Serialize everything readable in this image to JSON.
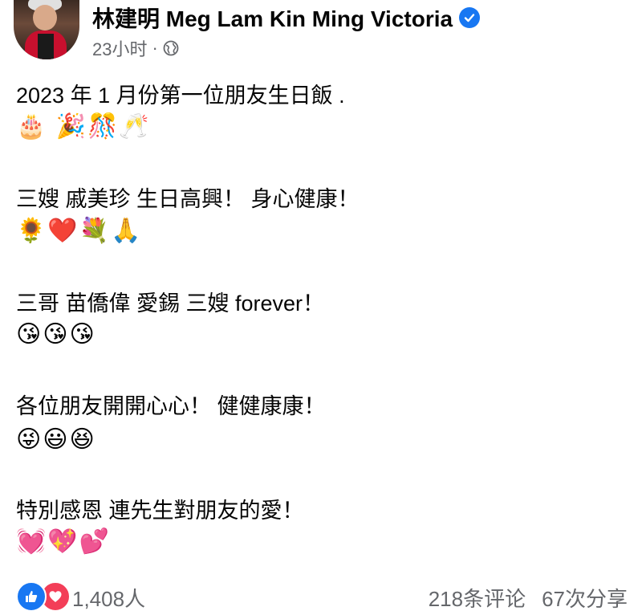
{
  "post": {
    "author": "林建明 Meg Lam Kin Ming Victoria",
    "timestamp": "23小时",
    "separator": "·",
    "audience_icon": "globe-icon",
    "verified_icon": "verified-badge-icon",
    "accent_color": "#1877f2"
  },
  "content": {
    "lines": [
      {
        "text": "2023 年 1 月份第一位朋友生日飯 .",
        "emoji": "🎂 🎉🎊🥂"
      },
      {
        "text": "三嫂 戚美珍 生日高興！ 身心健康！",
        "emoji": "🌻❤️💐🙏"
      },
      {
        "text": "三哥 苗僑偉 愛錫 三嫂 forever！",
        "emoji": "😘😘😘"
      },
      {
        "text": "各位朋友開開心心！ 健健康康！",
        "emoji": "😜😃😆"
      },
      {
        "text": "特別感恩 連先生對朋友的愛！",
        "emoji": "💓💖💕"
      }
    ]
  },
  "footer": {
    "reactions_count": "1,408人",
    "comments": "218条评论",
    "shares": "67次分享",
    "reaction_icons": [
      "like-icon",
      "love-icon"
    ]
  }
}
